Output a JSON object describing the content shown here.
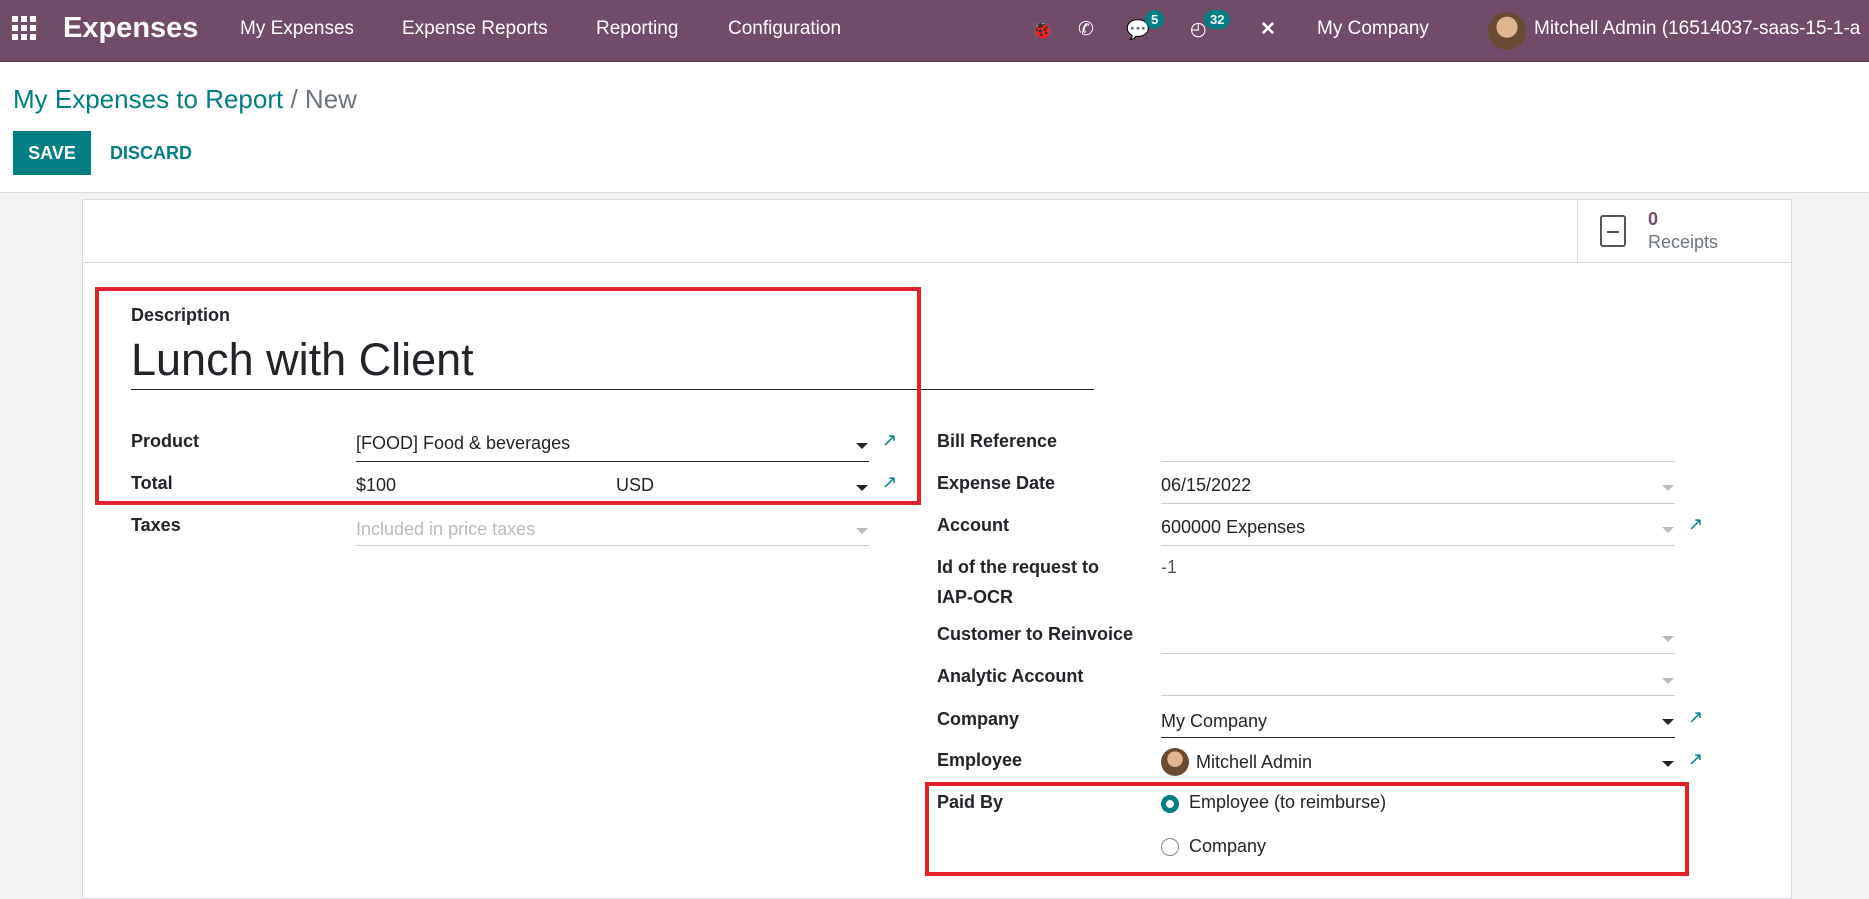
{
  "navbar": {
    "app_title": "Expenses",
    "menus": [
      "My Expenses",
      "Expense Reports",
      "Reporting",
      "Configuration"
    ],
    "chat_badge": "5",
    "activity_badge": "32",
    "company": "My Company",
    "user": "Mitchell Admin (16514037-saas-15-1-a"
  },
  "breadcrumb": {
    "parent": "My Expenses to Report",
    "current": "/ New"
  },
  "toolbar": {
    "save_label": "SAVE",
    "discard_label": "DISCARD"
  },
  "receipts": {
    "count": "0",
    "label": "Receipts"
  },
  "form": {
    "description_label": "Description",
    "description_value": "Lunch with Client",
    "product_label": "Product",
    "product_value": "[FOOD] Food & beverages",
    "total_label": "Total",
    "total_value": "$100",
    "currency_value": "USD",
    "taxes_label": "Taxes",
    "taxes_placeholder": "Included in price taxes",
    "bill_ref_label": "Bill Reference",
    "bill_ref_value": "",
    "date_label": "Expense Date",
    "date_value": "06/15/2022",
    "account_label": "Account",
    "account_value": "600000 Expenses",
    "ocr_label_1": "Id of the request to",
    "ocr_label_2": "IAP-OCR",
    "ocr_value": "-1",
    "customer_label": "Customer to Reinvoice",
    "analytic_label": "Analytic Account",
    "company_label": "Company",
    "company_value": "My Company",
    "employee_label": "Employee",
    "employee_value": "Mitchell Admin",
    "paid_by_label": "Paid By",
    "paid_by_options": [
      "Employee (to reimburse)",
      "Company"
    ],
    "paid_by_selected": "Employee (to reimburse)"
  },
  "colors": {
    "navbar": "#714b67",
    "accent": "#017e84",
    "highlight": "#e5202b"
  }
}
